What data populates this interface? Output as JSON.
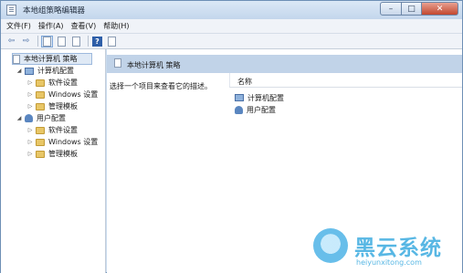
{
  "window": {
    "title": "本地组策略编辑器"
  },
  "menu": [
    "文件(F)",
    "操作(A)",
    "查看(V)",
    "帮助(H)"
  ],
  "toolbar": {
    "icons": [
      "back-arrow-icon",
      "forward-arrow-icon",
      "show-hide-tree-icon",
      "properties-icon",
      "export-list-icon",
      "help-icon",
      "filter-icon"
    ],
    "help_label": "?"
  },
  "tree": {
    "root": "本地计算机 策略",
    "computer_config": "计算机配置",
    "user_config": "用户配置",
    "software_settings": "软件设置",
    "windows_settings": "Windows 设置",
    "admin_templates": "管理模板"
  },
  "main": {
    "header_title": "本地计算机 策略",
    "description": "选择一个项目来查看它的描述。",
    "column_name": "名称",
    "items": [
      "计算机配置",
      "用户配置"
    ]
  },
  "watermark": {
    "text": "黑云系统",
    "url": "heiyunxitong.com"
  }
}
